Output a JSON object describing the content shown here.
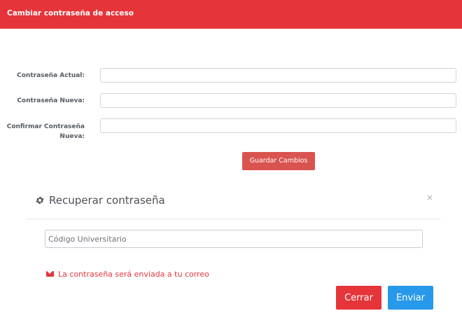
{
  "header": {
    "title": "Cambiar contraseña de acceso",
    "background_color": "#e5353a"
  },
  "change_password_form": {
    "fields": [
      {
        "label": "Contraseña Actual:",
        "value": ""
      },
      {
        "label": "Contraseña Nueva:",
        "value": ""
      },
      {
        "label": "Confirmar Contraseña Nueva:",
        "value": ""
      }
    ],
    "save_label": "Guardar Cambios",
    "save_color": "#d9534f"
  },
  "recover_modal": {
    "icon": "gear-icon",
    "title": "Recuperar contraseña",
    "close_symbol": "×",
    "code_placeholder": "Código Universitario",
    "code_value": "",
    "notice_icon": "envelope-icon",
    "notice_text": "La contraseña será enviada a tu correo",
    "notice_color": "#e5353a",
    "close_label": "Cerrar",
    "close_color": "#e5353a",
    "send_label": "Enviar",
    "send_color": "#2799ea"
  }
}
